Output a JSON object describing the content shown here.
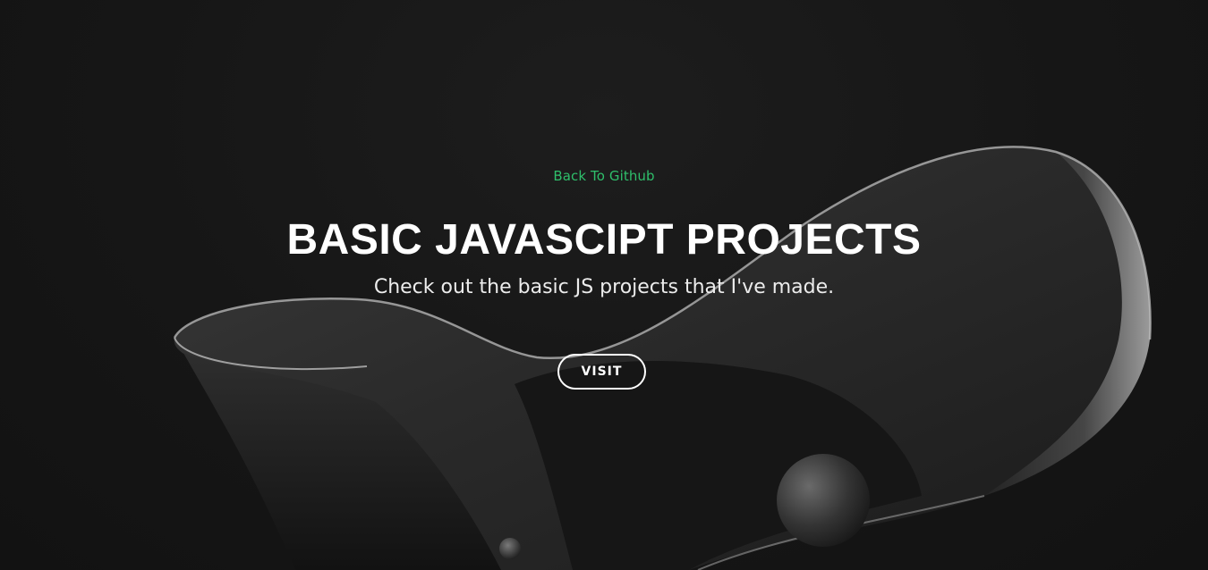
{
  "hero": {
    "back_link": "Back To Github",
    "title": "BASIC JAVASCIPT PROJECTS",
    "subtitle": "Check out the basic JS projects that I've made.",
    "visit_label": "VISIT"
  },
  "colors": {
    "background": "#141414",
    "link": "#2fbf6b",
    "text": "#ffffff",
    "button_border": "#ffffff"
  }
}
